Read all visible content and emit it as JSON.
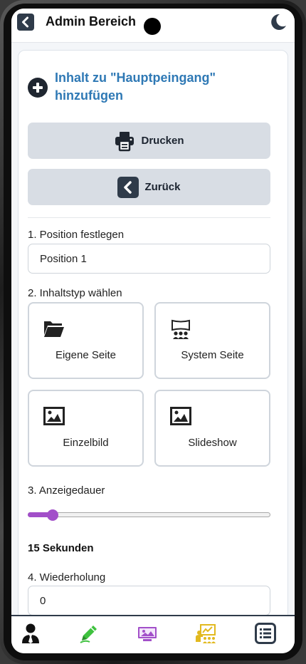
{
  "header": {
    "title": "Admin Bereich",
    "back_icon": "chevron-left-icon",
    "theme_icon": "moon-icon"
  },
  "form": {
    "add_title": "Inhalt zu \"Hauptpeingang\" hinzufügen",
    "print_label": "Drucken",
    "back_label": "Zurück",
    "step1_label": "1. Position festlegen",
    "position_value": "Position 1",
    "step2_label": "2. Inhaltstyp wählen",
    "content_types": [
      {
        "label": "Eigene Seite",
        "icon": "folder-open-icon"
      },
      {
        "label": "System Seite",
        "icon": "presentation-audience-icon"
      },
      {
        "label": "Einzelbild",
        "icon": "image-icon"
      },
      {
        "label": "Slideshow",
        "icon": "image-icon"
      }
    ],
    "step3_label": "3. Anzeigedauer",
    "duration_slider_fraction": 0.1,
    "duration_text": "15 Sekunden",
    "step4_label": "4. Wiederholung",
    "repeat_value": "0"
  },
  "nav": {
    "items": [
      {
        "icon": "user-tie-icon",
        "color": "#111111"
      },
      {
        "icon": "pencil-icon",
        "color": "#3fc23f"
      },
      {
        "icon": "photo-display-icon",
        "color": "#a24fc9"
      },
      {
        "icon": "chalkboard-teacher-icon",
        "color": "#e2b91f"
      },
      {
        "icon": "list-icon",
        "color": "#2f3b4a"
      }
    ]
  },
  "colors": {
    "accent_blue": "#2f79b5",
    "button_bg": "#d8dde4",
    "slider": "#a24fc9",
    "nav_border": "#2f3b4a"
  }
}
